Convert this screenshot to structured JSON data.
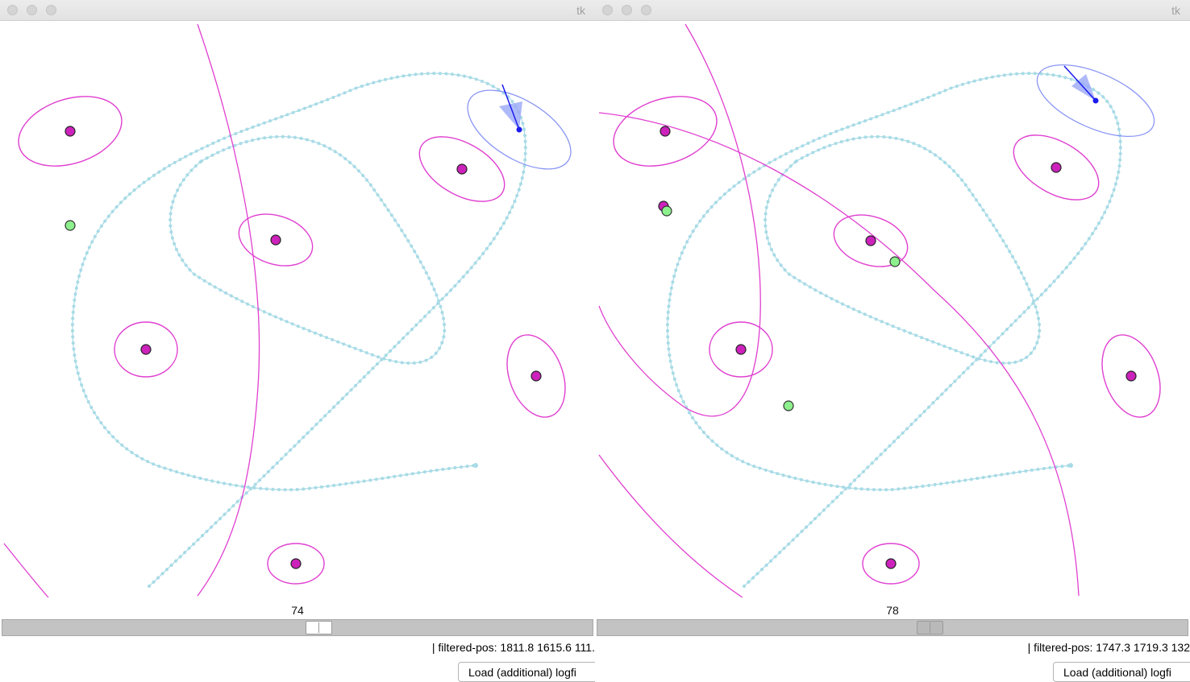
{
  "windows": [
    {
      "title": "tk",
      "frame_number": "74",
      "slider_value": 74,
      "status_text": "| filtered-pos: 1811.8 1615.6 111.",
      "load_button_label": "Load (additional) logfi"
    },
    {
      "title": "tk",
      "frame_number": "78",
      "slider_value": 78,
      "status_text": "| filtered-pos: 1747.3 1719.3 132",
      "load_button_label": "Load (additional) logfi"
    }
  ],
  "colors": {
    "landmark": "#cc22bb",
    "landmark_ellipse": "#e040d0",
    "trajectory": "#a8dbe6",
    "observation": "#8cf08c",
    "robot": "#1a1aee",
    "robot_ellipse": "#8a96f4",
    "robot_cone": "#9aa8f8"
  },
  "icons": {
    "title_buttons": "traffic-light-circle",
    "robot_marker": "robot-pose-icon"
  }
}
